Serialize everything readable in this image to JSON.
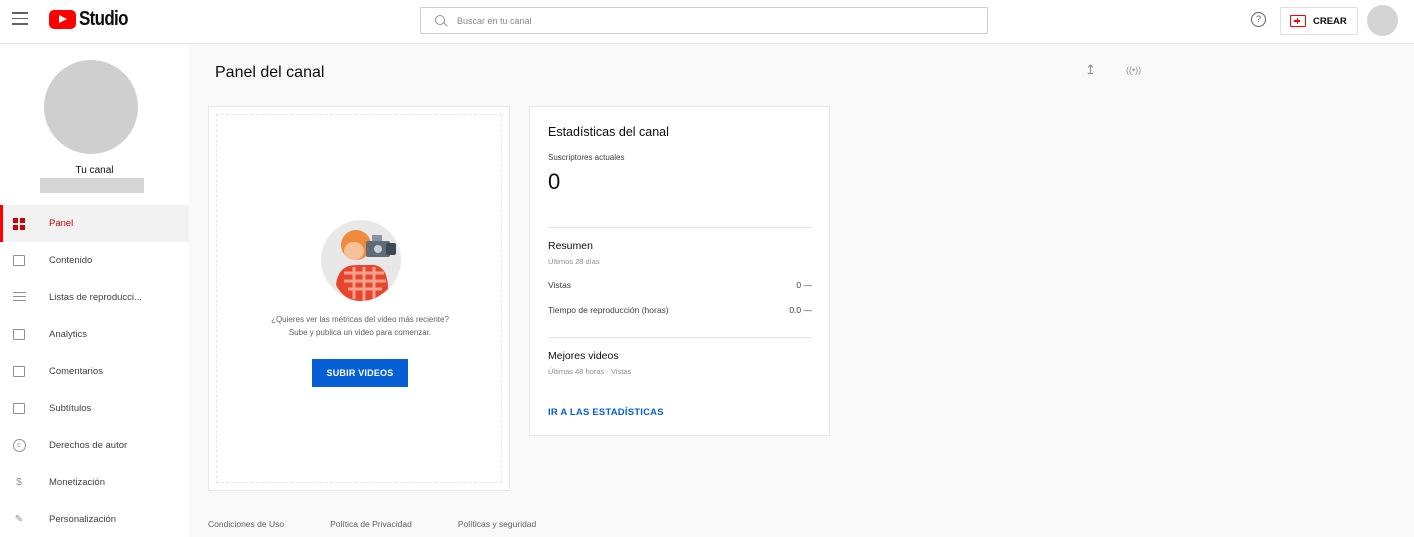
{
  "header": {
    "brand": "Studio",
    "search_placeholder": "Buscar en tu canal",
    "help_glyph": "?",
    "create_label": "CREAR"
  },
  "sidebar": {
    "channel_name": "Tu canal",
    "items": [
      {
        "label": "Panel",
        "icon": "dashboard-icon",
        "active": true
      },
      {
        "label": "Contenido",
        "icon": "content-icon"
      },
      {
        "label": "Listas de reproducci...",
        "icon": "playlist-icon"
      },
      {
        "label": "Analytics",
        "icon": "analytics-icon"
      },
      {
        "label": "Comentarios",
        "icon": "comments-icon"
      },
      {
        "label": "Subtítulos",
        "icon": "subtitles-icon"
      },
      {
        "label": "Derechos de autor",
        "icon": "copyright-icon"
      },
      {
        "label": "Monetización",
        "icon": "monetization-icon"
      },
      {
        "label": "Personalización",
        "icon": "customization-icon"
      }
    ]
  },
  "main": {
    "title": "Panel del canal",
    "upload_card": {
      "prompt_line1": "¿Quieres ver las métricas del video más reciente?",
      "prompt_line2": "Sube y publica un video para comenzar.",
      "button_label": "SUBIR VIDEOS"
    },
    "stats_card": {
      "title": "Estadísticas del canal",
      "subscribers_label": "Suscriptores actuales",
      "subscribers_value": "0",
      "summary_title": "Resumen",
      "summary_period": "Últimos 28 días",
      "metrics": [
        {
          "label": "Vistas",
          "value": "0 —"
        },
        {
          "label": "Tiempo de reproducción (horas)",
          "value": "0.0 —"
        }
      ],
      "top_videos_title": "Mejores videos",
      "top_videos_sub": "Últimas 48 horas · Vistas",
      "link_label": "IR A LAS ESTADÍSTICAS"
    }
  },
  "footer": {
    "links": [
      "Condiciones de Uso",
      "Política de Privacidad",
      "Políticas y seguridad"
    ]
  },
  "colors": {
    "brand_red": "#ff0000",
    "link_blue": "#065fd4",
    "active_red": "#cc0000"
  }
}
